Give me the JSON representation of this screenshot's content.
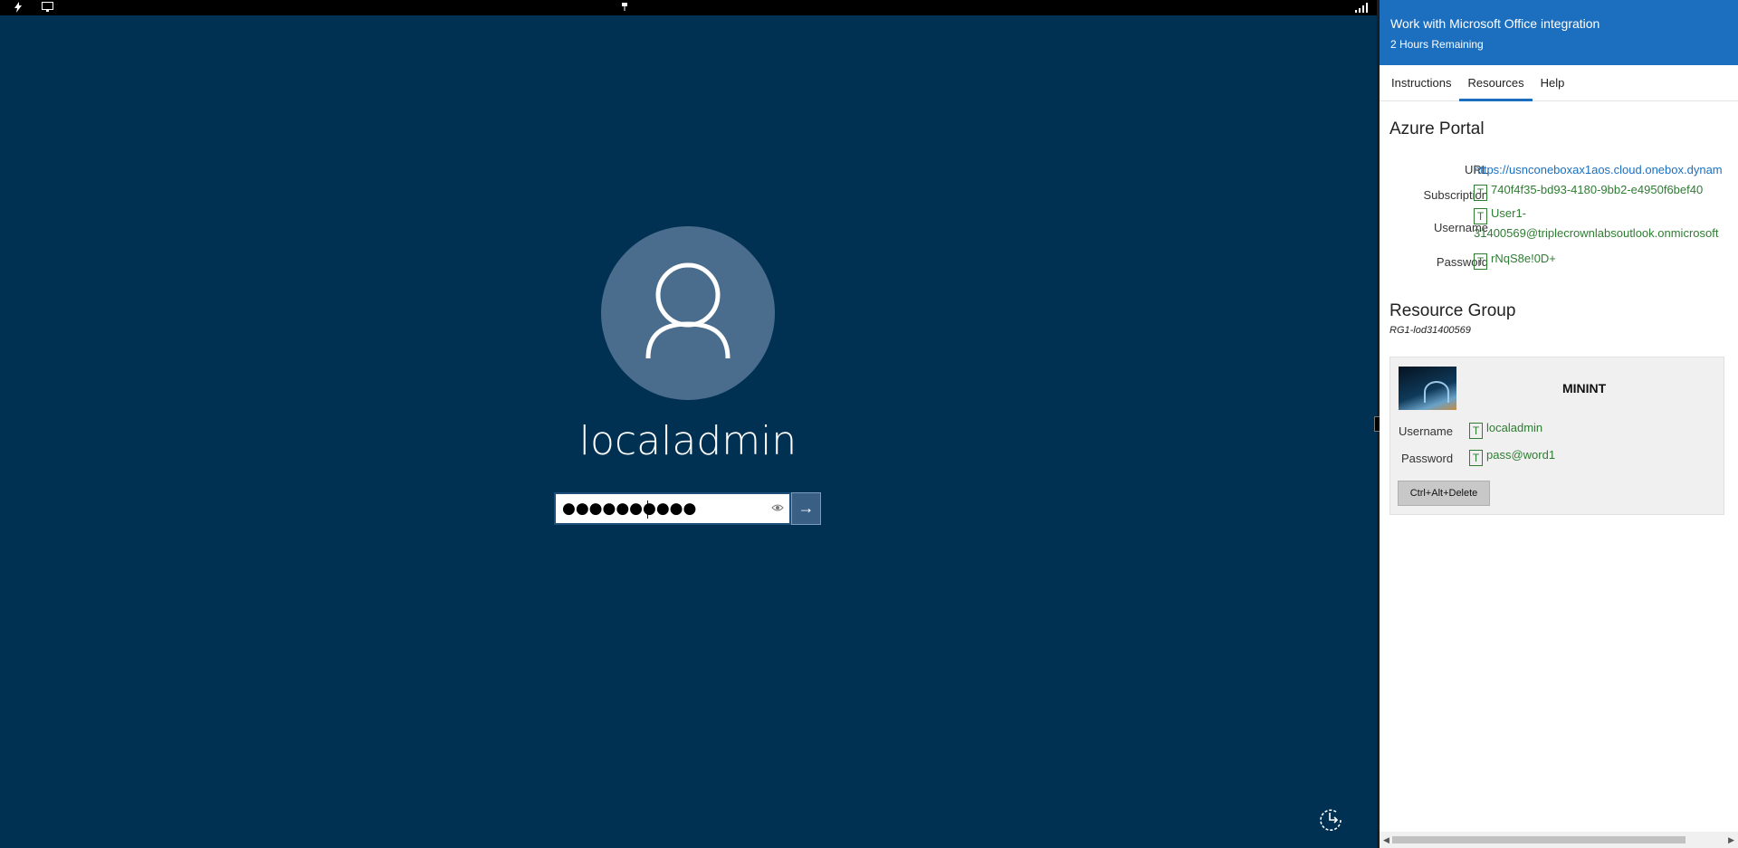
{
  "vm_screen": {
    "username": "localadmin",
    "password_mask": "●●●●●●●●●●",
    "submit_glyph": "→",
    "icons": [
      "lightning-icon",
      "monitor-icon",
      "pin-icon",
      "signal-icon",
      "eye-icon",
      "ease-of-access-icon"
    ]
  },
  "panel": {
    "title": "Work with Microsoft Office integration",
    "time_remaining": "2 Hours Remaining",
    "tabs": [
      {
        "label": "Instructions",
        "active": false
      },
      {
        "label": "Resources",
        "active": true
      },
      {
        "label": "Help",
        "active": false
      }
    ],
    "azure_portal": {
      "heading": "Azure Portal",
      "url_label": "URL",
      "url": "https://usnconeboxax1aos.cloud.onebox.dynam",
      "subscription_label": "Subscription",
      "subscription": "740f4f35-bd93-4180-9bb2-e4950f6bef40",
      "username_label": "Username",
      "username_line1": "User1-",
      "username_line2": "31400569@triplecrownlabsoutlook.onmicrosoft",
      "password_label": "Password",
      "password": "rNqS8e!0D+"
    },
    "resource_group": {
      "heading": "Resource Group",
      "name": "RG1-lod31400569"
    },
    "vm_card": {
      "name": "MININT",
      "username_label": "Username",
      "username": "localadmin",
      "password_label": "Password",
      "password": "pass@word1",
      "cad_button": "Ctrl+Alt+Delete"
    },
    "type_icon_glyph": "T"
  },
  "colors": {
    "vm_background": "#003152",
    "panel_header": "#1c6fbf",
    "credential_green": "#2e7d32"
  }
}
